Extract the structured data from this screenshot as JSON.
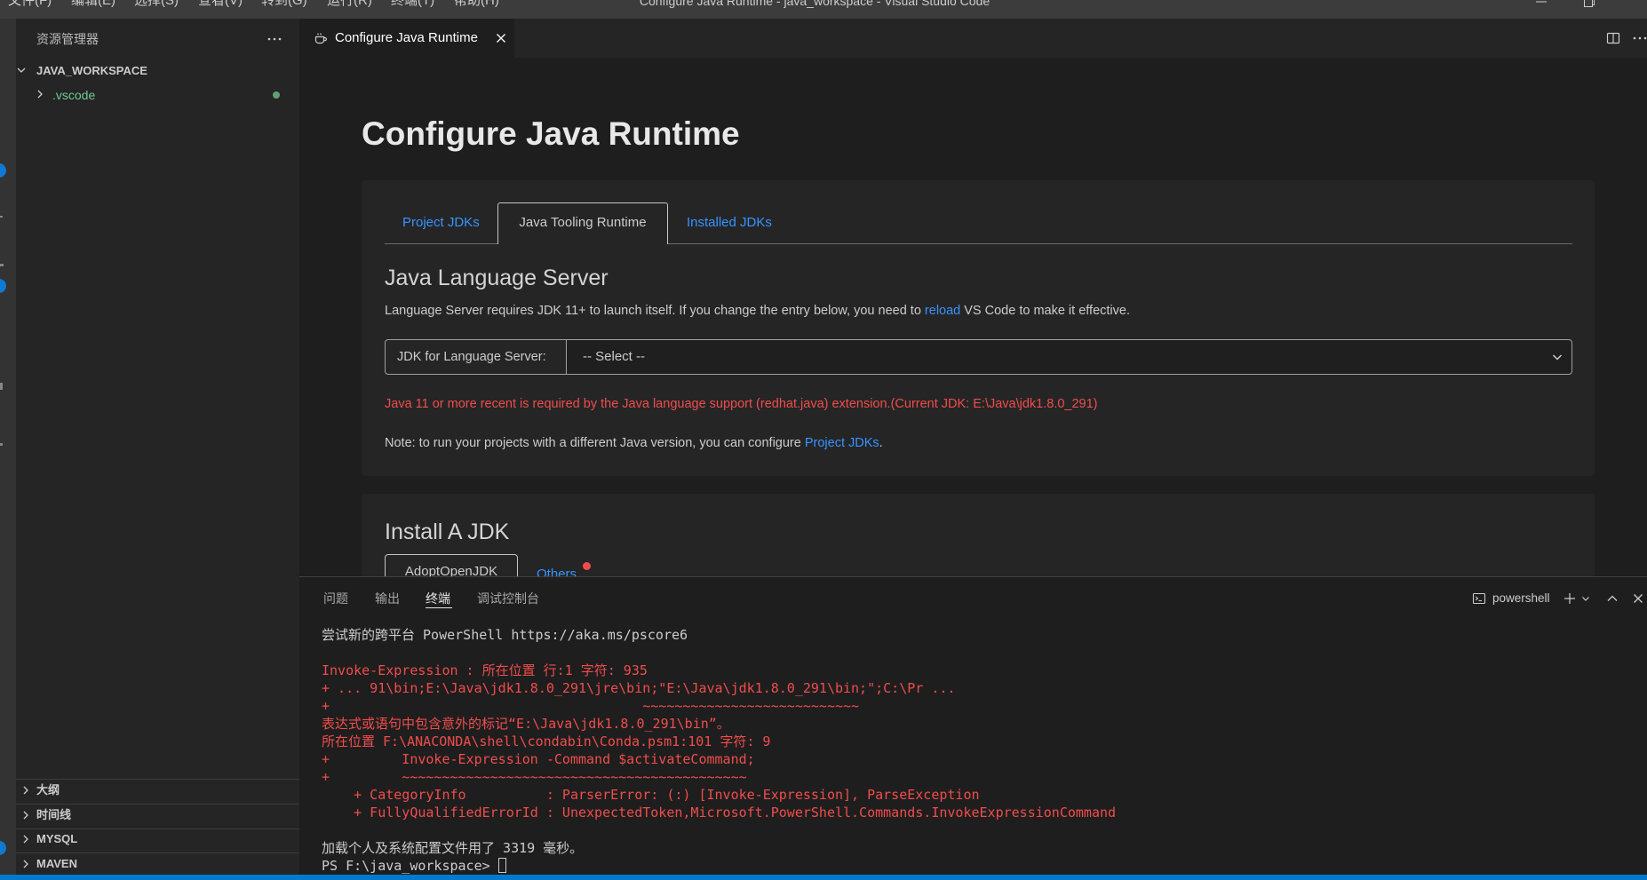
{
  "window": {
    "title": "Configure Java Runtime - java_workspace - Visual Studio Code",
    "menu": [
      "文件(F)",
      "编辑(E)",
      "选择(S)",
      "查看(V)",
      "转到(G)",
      "运行(R)",
      "终端(T)",
      "帮助(H)"
    ]
  },
  "sidebar": {
    "title": "资源管理器",
    "workspace": "JAVA_WORKSPACE",
    "tree": [
      {
        "label": ".vscode",
        "expanded": false,
        "has_changes_dot": true
      }
    ],
    "sections": [
      "大纲",
      "时间线",
      "MYSQL",
      "MAVEN"
    ]
  },
  "editor": {
    "tab": {
      "label": "Configure Java Runtime",
      "icon": "java-cup-icon"
    }
  },
  "page": {
    "title": "Configure Java Runtime",
    "tabs": [
      {
        "label": "Project JDKs",
        "active": false
      },
      {
        "label": "Java Tooling Runtime",
        "active": true
      },
      {
        "label": "Installed JDKs",
        "active": false
      }
    ],
    "language_server": {
      "heading": "Java Language Server",
      "description_before": "Language Server requires JDK 11+ to launch itself. If you change the entry below, you need to ",
      "reload_link": "reload",
      "description_after": " VS Code to make it effective.",
      "jdk_label": "JDK for Language Server:",
      "jdk_value": "-- Select --",
      "error": "Java 11 or more recent is required by the Java language support (redhat.java) extension.(Current JDK: E:\\Java\\jdk1.8.0_291)",
      "note_before": "Note: to run your projects with a different Java version, you can configure ",
      "note_link": "Project JDKs",
      "note_after": "."
    },
    "install": {
      "heading": "Install A JDK",
      "options": [
        {
          "label": "AdoptOpenJDK",
          "active": true
        },
        {
          "label": "Others",
          "active": false,
          "notification_dot": true
        }
      ]
    }
  },
  "panel": {
    "tabs": [
      {
        "label": "问题",
        "active": false
      },
      {
        "label": "输出",
        "active": false
      },
      {
        "label": "终端",
        "active": true
      },
      {
        "label": "调试控制台",
        "active": false
      }
    ],
    "terminal_name": "powershell",
    "lines": [
      {
        "text": "尝试新的跨平台 PowerShell https://aka.ms/pscore6",
        "error": false
      },
      {
        "text": "",
        "error": false
      },
      {
        "text": "Invoke-Expression : 所在位置 行:1 字符: 935",
        "error": true
      },
      {
        "text": "+ ... 91\\bin;E:\\Java\\jdk1.8.0_291\\jre\\bin;\"E:\\Java\\jdk1.8.0_291\\bin;\";C:\\Pr ...",
        "error": true
      },
      {
        "text": "+                                       ~~~~~~~~~~~~~~~~~~~~~~~~~~~",
        "error": true
      },
      {
        "text": "表达式或语句中包含意外的标记“E:\\Java\\jdk1.8.0_291\\bin”。",
        "error": true
      },
      {
        "text": "所在位置 F:\\ANACONDA\\shell\\condabin\\Conda.psm1:101 字符: 9",
        "error": true
      },
      {
        "text": "+         Invoke-Expression -Command $activateCommand;",
        "error": true
      },
      {
        "text": "+         ~~~~~~~~~~~~~~~~~~~~~~~~~~~~~~~~~~~~~~~~~~~",
        "error": true
      },
      {
        "text": "    + CategoryInfo          : ParserError: (:) [Invoke-Expression], ParseException",
        "error": true
      },
      {
        "text": "    + FullyQualifiedErrorId : UnexpectedToken,Microsoft.PowerShell.Commands.InvokeExpressionCommand",
        "error": true
      },
      {
        "text": "",
        "error": false
      },
      {
        "text": "加载个人及系统配置文件用了 3319 毫秒。",
        "error": false
      },
      {
        "text": "PS F:\\java_workspace> ",
        "error": false,
        "cursor": true
      }
    ]
  },
  "colors": {
    "accent": "#007acc",
    "link": "#3794ff",
    "error": "#f14c4c",
    "git_untracked": "#73c991",
    "badge": "#0e7ad3"
  }
}
